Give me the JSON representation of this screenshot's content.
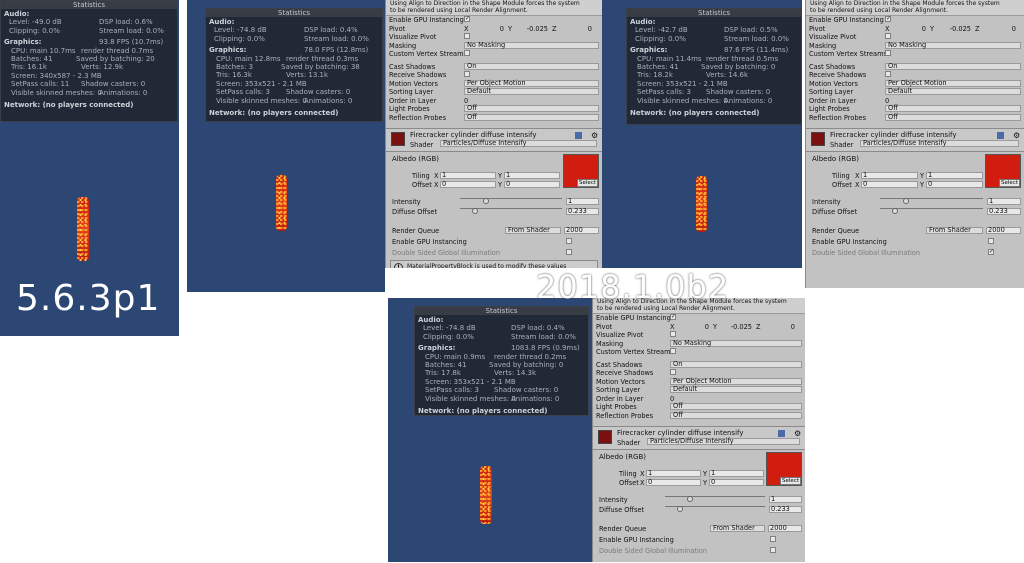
{
  "annotations": {
    "v1": "5.6.3p1",
    "v2": "2018.1.0b2"
  },
  "stats_title": "Statistics",
  "stats_labels": {
    "audio": "Audio:",
    "graphics": "Graphics:",
    "network": "Network: (no players connected)"
  },
  "panels": [
    {
      "level": "Level: -49.0 dB",
      "dsp": "DSP load: 0.6%",
      "clipping": "Clipping: 0.0%",
      "stream": "Stream load: 0.0%",
      "fps": "93.8 FPS (10.7ms)",
      "cpu": "CPU: main 10.7ms",
      "render": "render thread 0.7ms",
      "batches": "Batches: 41",
      "saved": "Saved by batching: 20",
      "tris": "Tris: 16.1k",
      "verts": "Verts: 12.9k",
      "screen": "Screen: 340x587 - 2.3 MB",
      "setpass": "SetPass calls: 11",
      "shadow": "Shadow casters: 0",
      "skinned": "Visible skinned meshes: 0",
      "anims": "Animations: 0"
    },
    {
      "level": "Level: -74.8 dB",
      "dsp": "DSP load: 0.4%",
      "clipping": "Clipping: 0.0%",
      "stream": "Stream load: 0.0%",
      "fps": "78.0 FPS (12.8ms)",
      "cpu": "CPU: main 12.8ms",
      "render": "render thread 0.3ms",
      "batches": "Batches: 3",
      "saved": "Saved by batching: 38",
      "tris": "Tris: 16.3k",
      "verts": "Verts: 13.1k",
      "screen": "Screen: 353x521 - 2.1 MB",
      "setpass": "SetPass calls: 3",
      "shadow": "Shadow casters: 0",
      "skinned": "Visible skinned meshes: 0",
      "anims": "Animations: 0"
    },
    {
      "level": "Level: -42.7 dB",
      "dsp": "DSP load: 0.5%",
      "clipping": "Clipping: 0.0%",
      "stream": "Stream load: 0.0%",
      "fps": "87.6 FPS (11.4ms)",
      "cpu": "CPU: main 11.4ms",
      "render": "render thread 0.5ms",
      "batches": "Batches: 41",
      "saved": "Saved by batching: 0",
      "tris": "Tris: 18.2k",
      "verts": "Verts: 14.6k",
      "screen": "Screen: 353x521 - 2.1 MB",
      "setpass": "SetPass calls: 3",
      "shadow": "Shadow casters: 0",
      "skinned": "Visible skinned meshes: 0",
      "anims": "Animations: 0"
    },
    {
      "level": "Level: -74.8 dB",
      "dsp": "DSP load: 0.4%",
      "clipping": "Clipping: 0.0%",
      "stream": "Stream load: 0.0%",
      "fps": "1083.8 FPS (0.9ms)",
      "cpu": "CPU: main 0.9ms",
      "render": "render thread 0.2ms",
      "batches": "Batches: 41",
      "saved": "Saved by batching: 0",
      "tris": "Tris: 17.8k",
      "verts": "Verts: 14.3k",
      "screen": "Screen: 353x521 - 2.1 MB",
      "setpass": "SetPass calls: 3",
      "shadow": "Shadow casters: 0",
      "skinned": "Visible skinned meshes: 0",
      "anims": "Animations: 0"
    }
  ],
  "inspector": {
    "warning_line1": "Using Align to Direction in the Shape Module forces the system",
    "warning_line2": "to be rendered using Local Render Alignment.",
    "enable_gpu_instancing": "Enable GPU Instancing",
    "pivot": "Pivot",
    "pivot_x": "0",
    "pivot_y": "-0.025",
    "pivot_z": "0",
    "x_label": "X",
    "y_label": "Y",
    "z_label": "Z",
    "visualize_pivot": "Visualize Pivot",
    "masking": "Masking",
    "masking_value": "No Masking",
    "custom_vertex_streams": "Custom Vertex Streams",
    "cast_shadows": "Cast Shadows",
    "cast_shadows_value": "On",
    "receive_shadows": "Receive Shadows",
    "motion_vectors": "Motion Vectors",
    "motion_vectors_value": "Per Object Motion",
    "sorting_layer": "Sorting Layer",
    "sorting_layer_value": "Default",
    "order_in_layer": "Order in Layer",
    "order_in_layer_value": "0",
    "light_probes": "Light Probes",
    "light_probes_value": "Off",
    "reflection_probes": "Reflection Probes",
    "reflection_probes_value": "Off",
    "material_name": "Firecracker cylinder diffuse intensify",
    "shader_label": "Shader",
    "shader_value": "Particles/Diffuse Intensify",
    "albedo": "Albedo (RGB)",
    "tiling": "Tiling",
    "offset": "Offset",
    "tiling_x": "1",
    "tiling_y": "1",
    "offset_x": "0",
    "offset_y": "0",
    "select": "Select",
    "intensity": "Intensity",
    "intensity_value": "1",
    "diffuse_offset": "Diffuse Offset",
    "diffuse_offset_value": "0.233",
    "render_queue": "Render Queue",
    "render_queue_mode": "From Shader",
    "render_queue_value": "2000",
    "double_sided": "Double Sided Global Illumination",
    "mpb_info": "MaterialPropertyBlock is used to modify these values"
  }
}
